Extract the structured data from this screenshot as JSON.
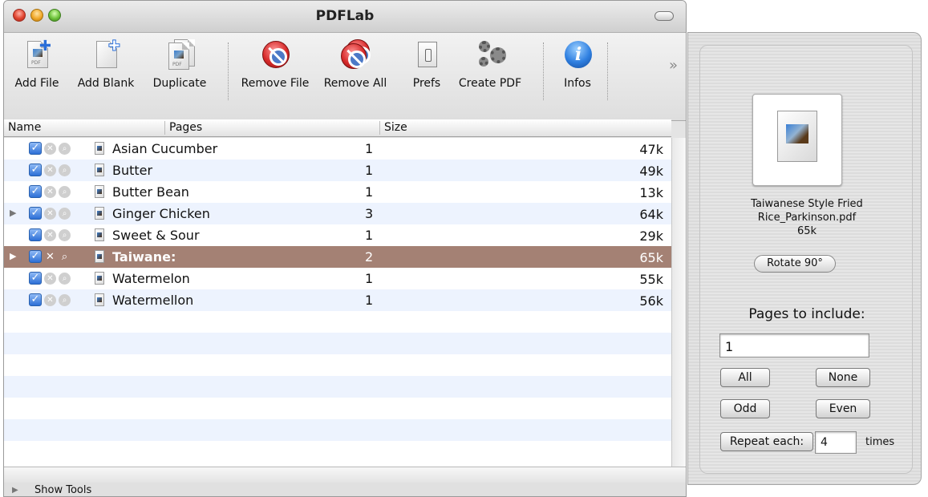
{
  "window": {
    "title": "PDFLab"
  },
  "toolbar": {
    "buttons": [
      {
        "label": "Add File",
        "icon": "add-file-icon"
      },
      {
        "label": "Add Blank",
        "icon": "add-blank-icon"
      },
      {
        "label": "Duplicate",
        "icon": "duplicate-icon"
      },
      {
        "label": "Remove File",
        "icon": "remove-file-icon"
      },
      {
        "label": "Remove All",
        "icon": "remove-all-icon"
      },
      {
        "label": "Prefs",
        "icon": "prefs-icon"
      },
      {
        "label": "Create PDF",
        "icon": "create-pdf-icon"
      },
      {
        "label": "Infos",
        "icon": "info-icon"
      }
    ],
    "overflow": "»"
  },
  "table": {
    "columns": [
      "Name",
      "Pages",
      "Size"
    ],
    "rows": [
      {
        "name": "Asian Cucumber",
        "pages": "1",
        "size": "47k",
        "checked": true,
        "expandable": false
      },
      {
        "name": "Butter",
        "pages": "1",
        "size": "49k",
        "checked": true,
        "expandable": false
      },
      {
        "name": "Butter Bean",
        "pages": "1",
        "size": "13k",
        "checked": true,
        "expandable": false
      },
      {
        "name": "Ginger Chicken",
        "pages": "3",
        "size": "64k",
        "checked": true,
        "expandable": true
      },
      {
        "name": "Sweet & Sour",
        "pages": "1",
        "size": "29k",
        "checked": true,
        "expandable": false
      },
      {
        "name": "Taiwane:",
        "pages": "2",
        "size": "65k",
        "checked": true,
        "expandable": true,
        "selected": true
      },
      {
        "name": "Watermelon",
        "pages": "1",
        "size": "55k",
        "checked": true,
        "expandable": false
      },
      {
        "name": "Watermellon",
        "pages": "1",
        "size": "56k",
        "checked": true,
        "expandable": false
      }
    ]
  },
  "footer": {
    "show_tools": "Show Tools"
  },
  "drawer": {
    "file_name_line1": "Taiwanese Style Fried",
    "file_name_line2": "Rice_Parkinson.pdf",
    "file_size": "65k",
    "rotate_label": "Rotate 90°",
    "pages_to_include_label": "Pages to include:",
    "pages_value": "1",
    "all_label": "All",
    "none_label": "None",
    "odd_label": "Odd",
    "even_label": "Even",
    "repeat_label": "Repeat each:",
    "repeat_value": "4",
    "times_label": "times"
  },
  "colors": {
    "selection": "#a48174",
    "alternate_row": "#edf3fe",
    "checkbox": "#2c6fd6"
  }
}
